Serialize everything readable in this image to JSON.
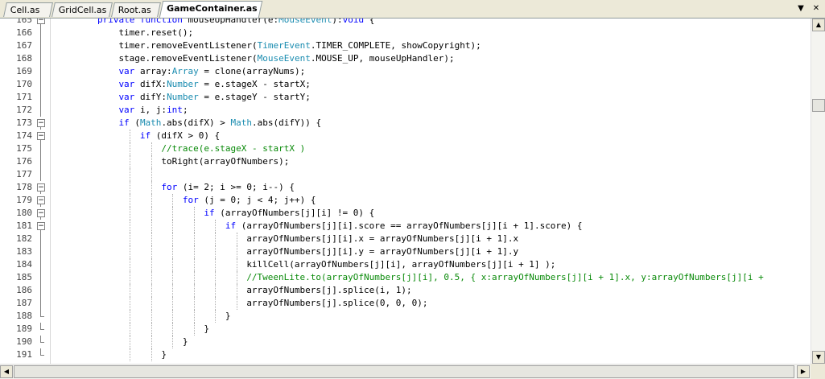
{
  "tabs": [
    {
      "label": "Cell.as",
      "active": false
    },
    {
      "label": "GridCell.as",
      "active": false
    },
    {
      "label": "Root.as",
      "active": false
    },
    {
      "label": "GameContainer.as",
      "active": true
    }
  ],
  "tab_controls": {
    "dropdown": "▼",
    "close": "✕"
  },
  "scroll": {
    "up": "▲",
    "down": "▼",
    "left": "◀",
    "right": "▶",
    "vertical_position": 0.24,
    "horizontal_position": 0.0
  },
  "colors": {
    "keyword": "#0000ff",
    "type": "#1a8cb0",
    "comment": "#0a8a0a",
    "text": "#000000"
  },
  "lines": [
    {
      "num": "165",
      "indent": 2,
      "fold": "minus",
      "code": [
        [
          "kw",
          "private function "
        ],
        [
          "",
          "mouseUpHandler(e:"
        ],
        [
          "ty",
          "MouseEvent"
        ],
        [
          "",
          "):"
        ],
        [
          "kw",
          "void"
        ],
        [
          "",
          " {"
        ]
      ]
    },
    {
      "num": "166",
      "indent": 3,
      "fold": "line",
      "code": [
        [
          "",
          "timer.reset();"
        ]
      ]
    },
    {
      "num": "167",
      "indent": 3,
      "fold": "line",
      "code": [
        [
          "",
          "timer.removeEventListener("
        ],
        [
          "ty",
          "TimerEvent"
        ],
        [
          "",
          ".TIMER_COMPLETE, showCopyright);"
        ]
      ]
    },
    {
      "num": "168",
      "indent": 3,
      "fold": "line",
      "code": [
        [
          "",
          "stage.removeEventListener("
        ],
        [
          "ty",
          "MouseEvent"
        ],
        [
          "",
          ".MOUSE_UP, mouseUpHandler);"
        ]
      ]
    },
    {
      "num": "169",
      "indent": 3,
      "fold": "line",
      "code": [
        [
          "kw",
          "var "
        ],
        [
          "",
          "array:"
        ],
        [
          "ty",
          "Array"
        ],
        [
          "",
          " = clone(arrayNums);"
        ]
      ]
    },
    {
      "num": "170",
      "indent": 3,
      "fold": "line",
      "code": [
        [
          "kw",
          "var "
        ],
        [
          "",
          "difX:"
        ],
        [
          "ty",
          "Number"
        ],
        [
          "",
          " = e.stageX - startX;"
        ]
      ]
    },
    {
      "num": "171",
      "indent": 3,
      "fold": "line",
      "code": [
        [
          "kw",
          "var "
        ],
        [
          "",
          "difY:"
        ],
        [
          "ty",
          "Number"
        ],
        [
          "",
          " = e.stageY - startY;"
        ]
      ]
    },
    {
      "num": "172",
      "indent": 3,
      "fold": "line",
      "code": [
        [
          "kw",
          "var "
        ],
        [
          "",
          "i, j:"
        ],
        [
          "kw",
          "int"
        ],
        [
          "",
          ";"
        ]
      ]
    },
    {
      "num": "173",
      "indent": 3,
      "fold": "minus",
      "code": [
        [
          "kw",
          "if "
        ],
        [
          "",
          "("
        ],
        [
          "ty",
          "Math"
        ],
        [
          "",
          ".abs(difX) > "
        ],
        [
          "ty",
          "Math"
        ],
        [
          "",
          ".abs(difY)) {"
        ]
      ]
    },
    {
      "num": "174",
      "indent": 4,
      "fold": "minus",
      "code": [
        [
          "kw",
          "if "
        ],
        [
          "",
          "(difX > 0) {"
        ]
      ]
    },
    {
      "num": "175",
      "indent": 5,
      "fold": "line",
      "code": [
        [
          "cm",
          "//trace(e.stageX - startX )"
        ]
      ]
    },
    {
      "num": "176",
      "indent": 5,
      "fold": "line",
      "code": [
        [
          "",
          "toRight(arrayOfNumbers);"
        ]
      ]
    },
    {
      "num": "177",
      "indent": 5,
      "fold": "line",
      "code": []
    },
    {
      "num": "178",
      "indent": 5,
      "fold": "minus",
      "code": [
        [
          "kw",
          "for "
        ],
        [
          "",
          "(i= 2; i >= 0; i--) {"
        ]
      ]
    },
    {
      "num": "179",
      "indent": 6,
      "fold": "minus",
      "code": [
        [
          "kw",
          "for "
        ],
        [
          "",
          "(j = 0; j < 4; j++) {"
        ]
      ]
    },
    {
      "num": "180",
      "indent": 7,
      "fold": "minus",
      "code": [
        [
          "kw",
          "if "
        ],
        [
          "",
          "(arrayOfNumbers[j][i] != 0) {"
        ]
      ]
    },
    {
      "num": "181",
      "indent": 8,
      "fold": "minus",
      "code": [
        [
          "kw",
          "if "
        ],
        [
          "",
          "(arrayOfNumbers[j][i].score == arrayOfNumbers[j][i + 1].score) {"
        ]
      ]
    },
    {
      "num": "182",
      "indent": 9,
      "fold": "line",
      "code": [
        [
          "",
          "arrayOfNumbers[j][i].x = arrayOfNumbers[j][i + 1].x"
        ]
      ]
    },
    {
      "num": "183",
      "indent": 9,
      "fold": "line",
      "code": [
        [
          "",
          "arrayOfNumbers[j][i].y = arrayOfNumbers[j][i + 1].y"
        ]
      ]
    },
    {
      "num": "184",
      "indent": 9,
      "fold": "line",
      "code": [
        [
          "",
          "killCell(arrayOfNumbers[j][i], arrayOfNumbers[j][i + 1] );"
        ]
      ]
    },
    {
      "num": "185",
      "indent": 9,
      "fold": "line",
      "code": [
        [
          "cm",
          "//TweenLite.to(arrayOfNumbers[j][i], 0.5, { x:arrayOfNumbers[j][i + 1].x, y:arrayOfNumbers[j][i +"
        ]
      ]
    },
    {
      "num": "186",
      "indent": 9,
      "fold": "line",
      "code": [
        [
          "",
          "arrayOfNumbers[j].splice(i, 1);"
        ]
      ]
    },
    {
      "num": "187",
      "indent": 9,
      "fold": "line",
      "code": [
        [
          "",
          "arrayOfNumbers[j].splice(0, 0, 0);"
        ]
      ]
    },
    {
      "num": "188",
      "indent": 8,
      "fold": "end",
      "code": [
        [
          "",
          "}"
        ]
      ]
    },
    {
      "num": "189",
      "indent": 7,
      "fold": "end",
      "code": [
        [
          "",
          "}"
        ]
      ]
    },
    {
      "num": "190",
      "indent": 6,
      "fold": "end",
      "code": [
        [
          "",
          "}"
        ]
      ]
    },
    {
      "num": "191",
      "indent": 5,
      "fold": "end",
      "code": [
        [
          "",
          "}"
        ]
      ]
    }
  ]
}
